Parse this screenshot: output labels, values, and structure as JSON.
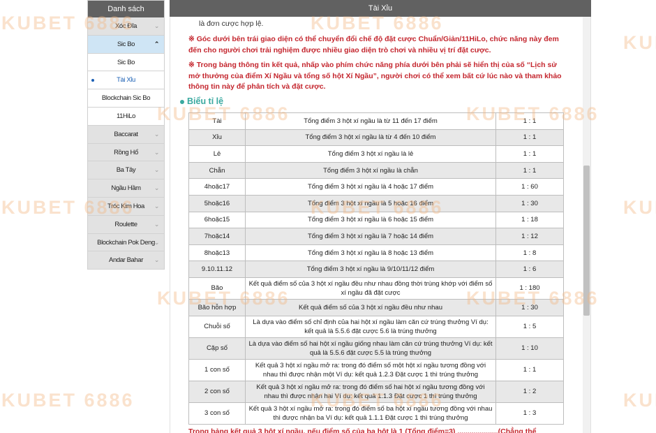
{
  "sidebar": {
    "header": "Danh sách",
    "items": [
      {
        "label": "Xóc Đĩa",
        "style": "gray",
        "chevron": "down"
      },
      {
        "label": "Sic Bo",
        "style": "active",
        "chevron": "up"
      },
      {
        "label": "Sic Bo",
        "style": "white",
        "chevron": ""
      },
      {
        "label": "Tài Xỉu",
        "style": "white",
        "chevron": "",
        "selected": true
      },
      {
        "label": "Blockchain Sic Bo",
        "style": "white",
        "chevron": ""
      },
      {
        "label": "11HiLo",
        "style": "white",
        "chevron": ""
      },
      {
        "label": "Baccarat",
        "style": "gray",
        "chevron": "down"
      },
      {
        "label": "Rồng Hổ",
        "style": "gray",
        "chevron": "down"
      },
      {
        "label": "Ba Tây",
        "style": "gray",
        "chevron": "down"
      },
      {
        "label": "Ngầu Hầm",
        "style": "gray",
        "chevron": "down"
      },
      {
        "label": "Tróc Kim Hoa",
        "style": "gray",
        "chevron": "down"
      },
      {
        "label": "Roulette",
        "style": "gray",
        "chevron": "down"
      },
      {
        "label": "Blockchain Pok Deng",
        "style": "gray",
        "chevron": "down"
      },
      {
        "label": "Andar Bahar",
        "style": "gray",
        "chevron": "down"
      }
    ]
  },
  "main": {
    "header": "Tài Xỉu",
    "top_fragment": "là đơn cược hợp lệ.",
    "note1": "※ Góc dưới bên trái giao diện có thể chuyển đổi chế độ đặt cược Chuẩn/Giản/11HiLo, chức năng này đem đến cho người chơi trải nghiệm được nhiều giao diện trò chơi và nhiều vị trí đặt cược.",
    "note2": "※ Trong bảng thông tin kết quả, nhấp vào phím chức năng phía dưới bên phải sẽ hiển thị của số “Lịch sử mở thưởng của điểm Xí Ngầu và tổng số hột Xí Ngầu”, người chơi có thể xem bất cứ lúc nào và tham khảo thông tin này để phân tích và đặt cược.",
    "section_title": "Biểu tỉ lệ",
    "bottom_fragment": "Trong bảng kết quả 3 hột xí ngầu, nếu điểm số của ba hột là 1 (Tổng điểm=3) ....................(Chẳng thể"
  },
  "odds_table": [
    {
      "name": "Tài",
      "desc": "Tổng điểm 3 hột xí ngầu là từ 11 đến 17 điểm",
      "odds": "1 : 1"
    },
    {
      "name": "Xỉu",
      "desc": "Tổng điểm 3 hột xí ngầu là từ 4 đến 10 điểm",
      "odds": "1 : 1"
    },
    {
      "name": "Lẻ",
      "desc": "Tổng điểm 3 hột xí ngầu là lẻ",
      "odds": "1 : 1"
    },
    {
      "name": "Chẵn",
      "desc": "Tổng điểm 3 hột xí ngầu là chẵn",
      "odds": "1 : 1"
    },
    {
      "name": "4hoặc17",
      "desc": "Tổng điểm 3 hột xí ngầu là 4 hoặc 17 điểm",
      "odds": "1 : 60"
    },
    {
      "name": "5hoặc16",
      "desc": "Tổng điểm 3 hột xí ngầu là 5 hoặc 16 điểm",
      "odds": "1 : 30"
    },
    {
      "name": "6hoặc15",
      "desc": "Tổng điểm 3 hột xí ngầu là 6 hoặc 15 điểm",
      "odds": "1 : 18"
    },
    {
      "name": "7hoặc14",
      "desc": "Tổng điểm 3 hột xí ngầu là 7 hoặc 14 điểm",
      "odds": "1 : 12"
    },
    {
      "name": "8hoặc13",
      "desc": "Tổng điểm 3 hột xí ngầu là 8 hoặc 13 điểm",
      "odds": "1 : 8"
    },
    {
      "name": "9.10.11.12",
      "desc": "Tổng điểm 3 hột xí ngầu là 9/10/11/12 điểm",
      "odds": "1 : 6"
    },
    {
      "name": "Bão",
      "desc": "Kết quả điểm số của 3 hột xí ngầu đều như nhau đồng thời trùng khớp với điểm số xí ngầu đã đặt cược",
      "odds": "1 : 180"
    },
    {
      "name": "Bão hỗn hợp",
      "desc": "Kết quả điểm số của 3 hột xí ngầu đều như nhau",
      "odds": "1 : 30"
    },
    {
      "name": "Chuỗi số",
      "desc": "Là dựa vào điểm số chỉ định của hai hột xí ngầu làm căn cứ trúng thưởng Ví dụ: kết quả là 5.5.6 đặt cược 5.6 là trúng thưởng",
      "odds": "1 : 5"
    },
    {
      "name": "Cặp số",
      "desc": "Là dựa vào điểm số hai hột xí ngầu giống nhau làm căn cứ trúng thưởng Ví dụ: kết quả là 5.5.6 đặt cược 5.5 là trúng thưởng",
      "odds": "1 : 10"
    },
    {
      "name": "1 con số",
      "desc": "Kết quả 3 hột xí ngầu mở ra: trong đó điểm số một hột xí ngầu tương đồng với nhau thì được nhận một Ví dụ: kết quả 1.2.3 Đặt cược 1 thì trúng thưởng",
      "odds": "1 : 1"
    },
    {
      "name": "2 con số",
      "desc": "Kết quả 3 hột xí ngầu mở ra: trong đó điểm số hai hột xí ngầu tương đồng với nhau thì được nhận hai Ví dụ: kết quả 1.1.3 Đặt cược 1 thì trúng thưởng",
      "odds": "1 : 2"
    },
    {
      "name": "3 con số",
      "desc": "Kết quả 3 hột xí ngầu mở ra: trong đó điểm số ba hột xí ngầu tương đồng với nhau thì được nhận ba Ví dụ: kết quả 1.1.1 Đặt cược 1 thì trúng thưởng",
      "odds": "1 : 3"
    }
  ],
  "watermark": {
    "text": "KUBET 6886"
  },
  "colors": {
    "header_bg": "#616161",
    "note_red": "#c4262e",
    "section_teal": "#3aa9a0",
    "active_item": "#cfe5f5"
  }
}
